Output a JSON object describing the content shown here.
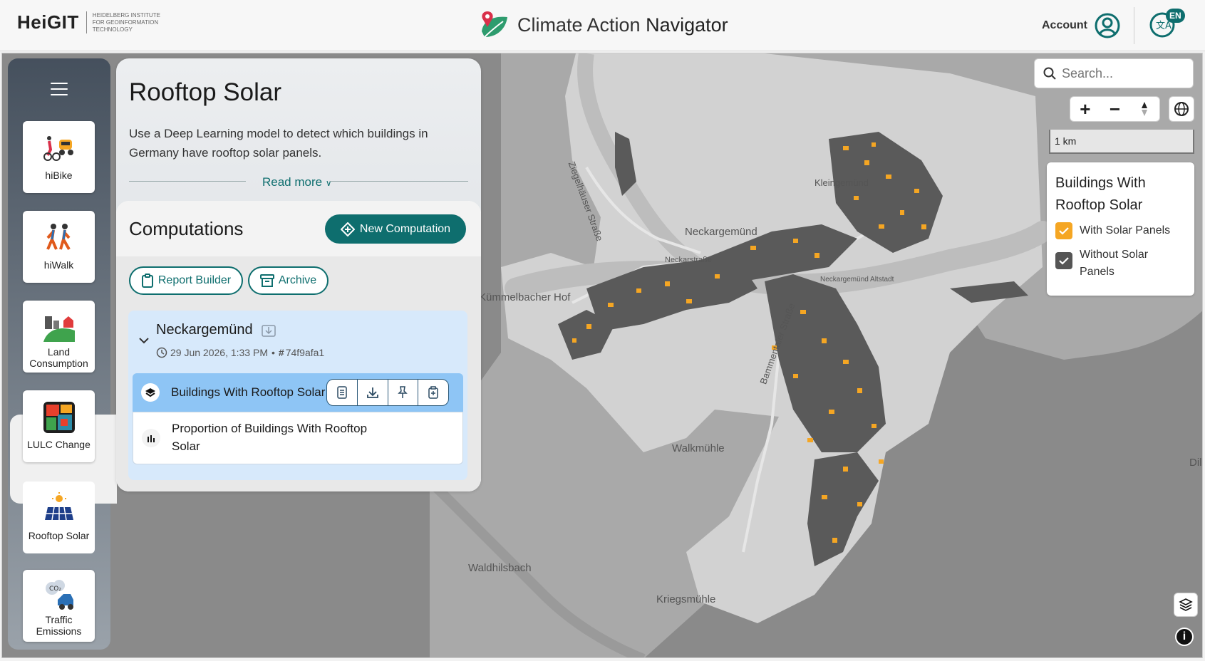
{
  "header": {
    "logo_word": "HeiGIT",
    "logo_sub": "Heidelberg Institute for Geoinformation Technology",
    "app_title_light": "Climate Action",
    "app_title_strong": "Navigator",
    "account_label": "Account",
    "language_code": "EN"
  },
  "sidebar": {
    "tools": [
      {
        "label": "hiBike",
        "icon": "bike-car-icon"
      },
      {
        "label": "hiWalk",
        "icon": "walkers-icon"
      },
      {
        "label": "Land Consumption",
        "icon": "land-consumption-icon"
      },
      {
        "label": "LULC Change",
        "icon": "lulc-change-icon"
      },
      {
        "label": "Rooftop Solar",
        "icon": "solar-panel-icon",
        "active": true
      },
      {
        "label": "Traffic Emissions",
        "icon": "traffic-emissions-icon"
      }
    ]
  },
  "panel": {
    "title": "Rooftop Solar",
    "description": "Use a Deep Learning model to detect which buildings in Germany have rooftop solar panels.",
    "read_more": "Read more",
    "computations_title": "Computations",
    "new_computation": "New Computation",
    "report_builder": "Report Builder",
    "archive": "Archive",
    "computation": {
      "name": "Neckargemünd",
      "date": "29 Jun 2026, 1:33 PM",
      "separator": "•",
      "hash": "74f9afa1",
      "layers": [
        {
          "label": "Buildings With Rooftop Solar",
          "selected": true
        },
        {
          "label": "Proportion of Buildings With Rooftop Solar",
          "selected": false
        }
      ]
    }
  },
  "map": {
    "search_placeholder": "Search...",
    "scale_label": "1 km",
    "places": [
      {
        "name": "Ziegelhäuser Straße"
      },
      {
        "name": "Neckargemünd"
      },
      {
        "name": "Kleingemünd"
      },
      {
        "name": "Kümmelbacher Hof"
      },
      {
        "name": "Neckarstraße"
      },
      {
        "name": "Bammentaler Straße"
      },
      {
        "name": "Walkmühle"
      },
      {
        "name": "Waldhilsbach"
      },
      {
        "name": "Kriegsmühle"
      },
      {
        "name": "Dilsberg"
      },
      {
        "name": "Neckargemünd Altstadt"
      }
    ]
  },
  "legend": {
    "title": "Buildings With Rooftop Solar",
    "items": [
      {
        "label": "With Solar Panels",
        "color": "#f5a623"
      },
      {
        "label": "Without Solar Panels",
        "color": "#555555"
      }
    ]
  },
  "colors": {
    "accent": "#0e6e6e",
    "selected_row": "#8ec5f5",
    "computation_bg": "#d7e9fb"
  }
}
